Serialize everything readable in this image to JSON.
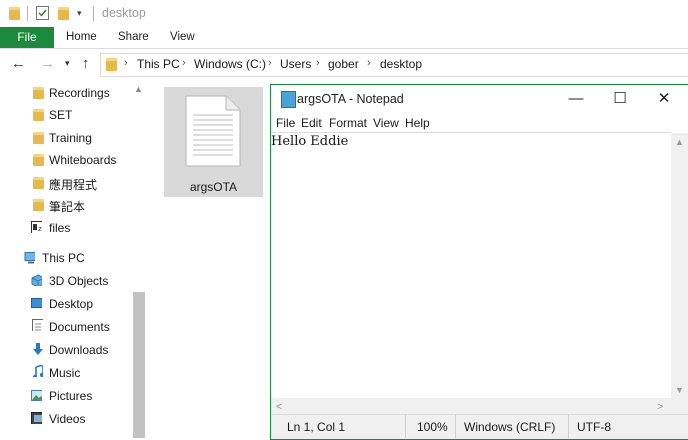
{
  "titlebar": {
    "path_label": "desktop"
  },
  "ribbon": {
    "file": "File",
    "home": "Home",
    "share": "Share",
    "view": "View"
  },
  "address": {
    "crumbs": [
      "This PC",
      "Windows (C:)",
      "Users",
      "gober",
      "desktop"
    ]
  },
  "sidebar": {
    "items": [
      {
        "label": "Recordings",
        "icon": "folder-icon"
      },
      {
        "label": "SET",
        "icon": "folder-icon"
      },
      {
        "label": "Training",
        "icon": "folder-icon"
      },
      {
        "label": "Whiteboards",
        "icon": "folder-icon"
      },
      {
        "label": "應用程式",
        "icon": "folder-icon"
      },
      {
        "label": "筆記本",
        "icon": "folder-icon"
      },
      {
        "label": "files",
        "icon": "archive-icon"
      },
      {
        "label": "This PC",
        "icon": "computer-icon"
      },
      {
        "label": "3D Objects",
        "icon": "3d-objects-icon"
      },
      {
        "label": "Desktop",
        "icon": "desktop-icon"
      },
      {
        "label": "Documents",
        "icon": "documents-icon"
      },
      {
        "label": "Downloads",
        "icon": "downloads-icon"
      },
      {
        "label": "Music",
        "icon": "music-icon"
      },
      {
        "label": "Pictures",
        "icon": "pictures-icon"
      },
      {
        "label": "Videos",
        "icon": "videos-icon"
      }
    ]
  },
  "file": {
    "name": "argsOTA"
  },
  "notepad": {
    "title": "argsOTA - Notepad",
    "menu": [
      "File",
      "Edit",
      "Format",
      "View",
      "Help"
    ],
    "content": "Hello Eddie",
    "status": {
      "position": "Ln 1, Col 1",
      "zoom": "100%",
      "line_ending": "Windows (CRLF)",
      "encoding": "UTF-8"
    }
  },
  "colors": {
    "accent": "#1b8a3a",
    "folder": "#e8b84a",
    "selection": "#d9d9d9"
  }
}
